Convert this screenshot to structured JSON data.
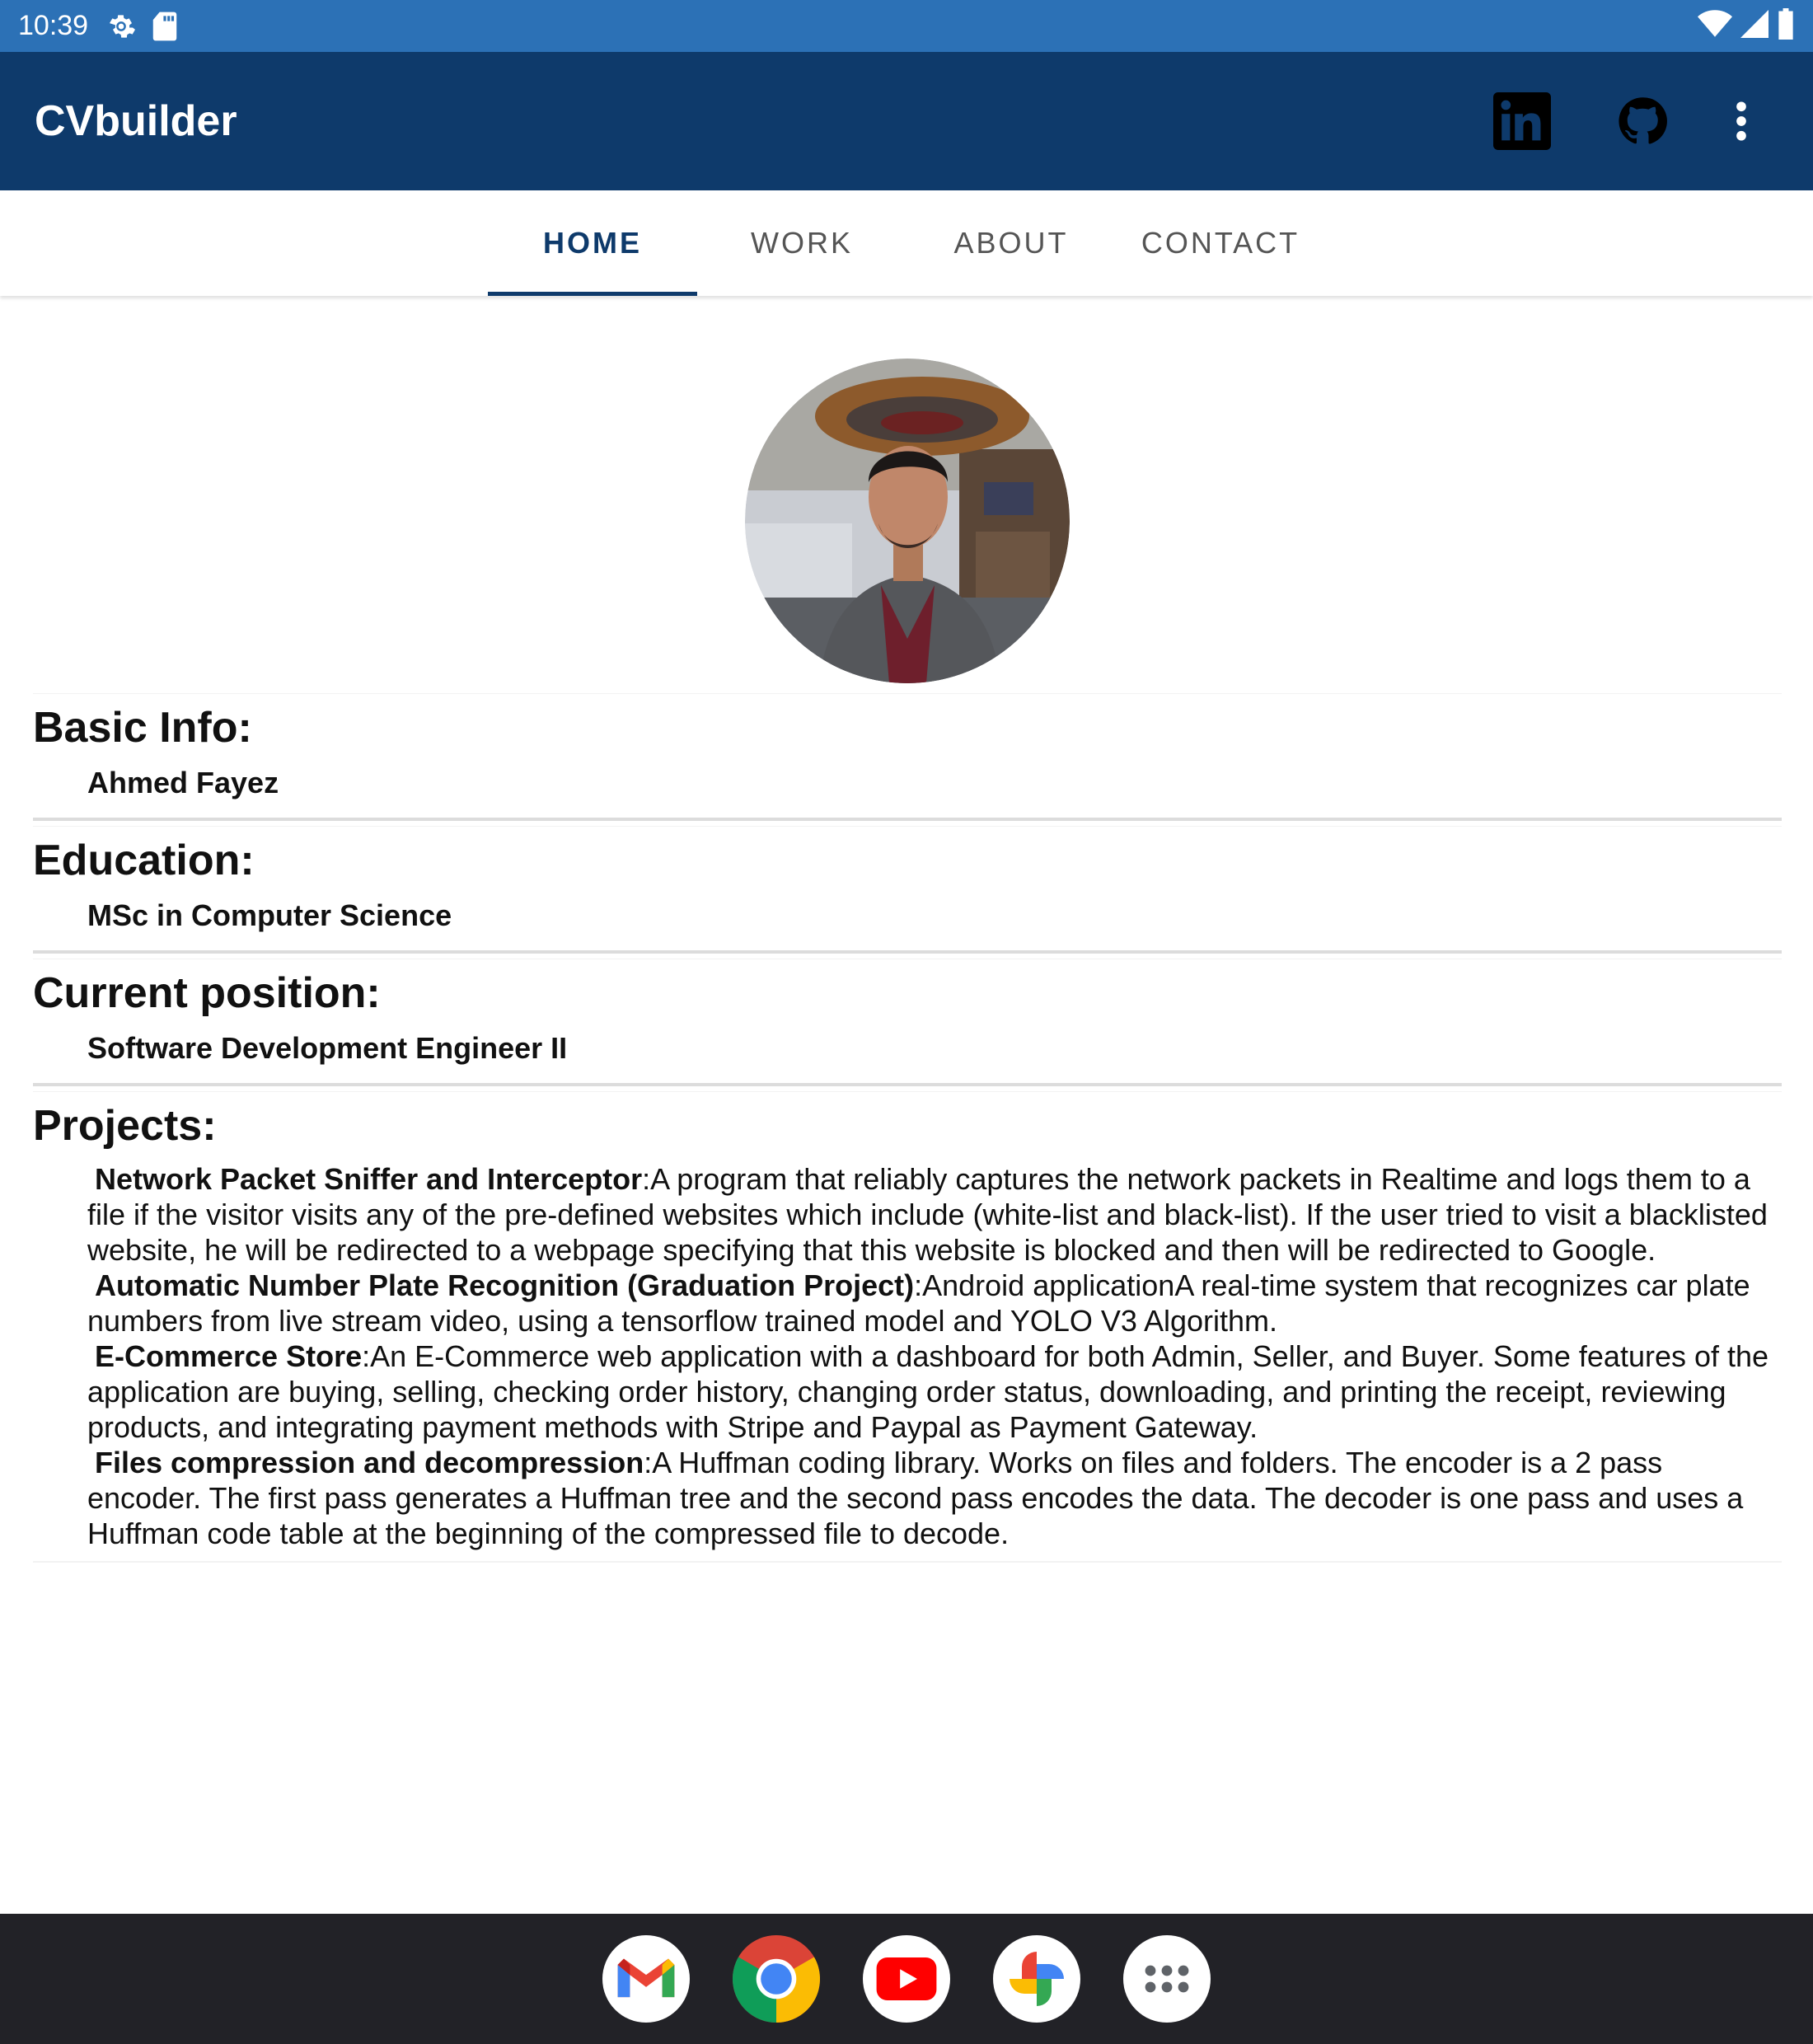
{
  "status_bar": {
    "time": "10:39"
  },
  "app_bar": {
    "title": "CVbuilder"
  },
  "tabs": [
    {
      "label": "HOME",
      "active": true
    },
    {
      "label": "WORK",
      "active": false
    },
    {
      "label": "ABOUT",
      "active": false
    },
    {
      "label": "CONTACT",
      "active": false
    }
  ],
  "sections": {
    "basic_info": {
      "title": "Basic Info:",
      "value": "Ahmed Fayez"
    },
    "education": {
      "title": "Education:",
      "value": "MSc in Computer Science"
    },
    "position": {
      "title": "Current position:",
      "value": "Software Development Engineer II"
    },
    "projects": {
      "title": "Projects:",
      "items": [
        {
          "name": "Network Packet Sniffer and Interceptor",
          "desc": ":A program that reliably captures the network packets in Realtime and logs them to a file if the visitor visits any of the pre-defined websites which include (white-list and black-list). If the user tried to visit a blacklisted website, he will be redirected to a webpage specifying that this website is blocked and then will be redirected to Google."
        },
        {
          "name": "Automatic Number Plate Recognition (Graduation Project)",
          "desc": ":Android applicationA real-time system that recognizes car plate numbers from live stream video, using a tensorflow trained model and YOLO V3 Algorithm."
        },
        {
          "name": "E-Commerce Store",
          "desc": ":An E-Commerce web application with a dashboard for both Admin, Seller, and Buyer. Some features of the application are buying, selling, checking order history, changing order status, downloading, and printing the receipt, reviewing products, and integrating payment methods with Stripe and Paypal as Payment Gateway."
        },
        {
          "name": "Files compression and decompression",
          "desc": ":A Huffman coding library. Works on files and folders. The encoder is a 2 pass encoder. The first pass generates a Huffman tree and the second pass encodes the data. The decoder is one pass and uses a Huffman code table at the beginning of the compressed file to decode."
        }
      ]
    }
  },
  "icons": {
    "settings": "gear-icon",
    "sd_card": "sd-card-icon",
    "wifi": "wifi-icon",
    "signal": "signal-icon",
    "battery": "battery-icon",
    "linkedin": "linkedin-icon",
    "github": "github-icon",
    "overflow": "more-vert-icon"
  },
  "dock": [
    "gmail-icon",
    "chrome-icon",
    "youtube-icon",
    "photos-icon",
    "app-drawer-icon"
  ],
  "colors": {
    "status_bar": "#2c71b6",
    "app_bar": "#0e3a6b",
    "tab_active": "#0e3a6b",
    "dock": "#222227"
  }
}
